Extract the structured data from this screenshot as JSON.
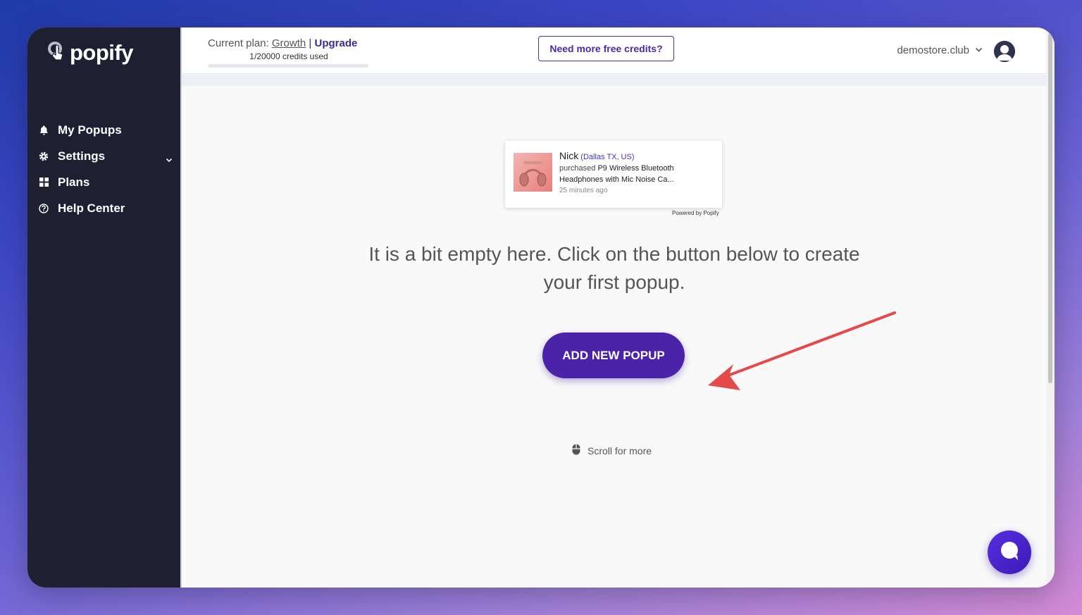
{
  "app": {
    "logo_text": "popify"
  },
  "sidebar": {
    "items": [
      {
        "label": "My Popups",
        "icon": "bell-icon"
      },
      {
        "label": "Settings",
        "icon": "gear-icon",
        "has_chevron": true
      },
      {
        "label": "Plans",
        "icon": "grid-icon"
      },
      {
        "label": "Help Center",
        "icon": "help-circle-icon"
      }
    ]
  },
  "header": {
    "plan_prefix": "Current plan: ",
    "plan_name": "Growth",
    "plan_separator": " | ",
    "upgrade_label": "Upgrade",
    "credits_text": "1/20000 credits used",
    "credits_fraction": 5e-05,
    "free_credits_label": "Need more free credits?",
    "store_name": "demostore.club"
  },
  "popup_preview": {
    "name": "Nick",
    "location": "(Dallas TX, US)",
    "action": "purchased",
    "product": "P9 Wireless Bluetooth Headphones with Mic Noise Ca...",
    "time": "25 minutes ago",
    "powered_by": "Powered by Popify"
  },
  "main": {
    "empty_message": "It is a bit empty here. Click on the button below to create your first popup.",
    "add_button_label": "ADD NEW POPUP",
    "scroll_hint": "Scroll for more"
  },
  "colors": {
    "sidebar_bg": "#1e1f31",
    "accent": "#4b23a8",
    "arrow": "#e34a4a",
    "chat": "#5a2ee0"
  }
}
